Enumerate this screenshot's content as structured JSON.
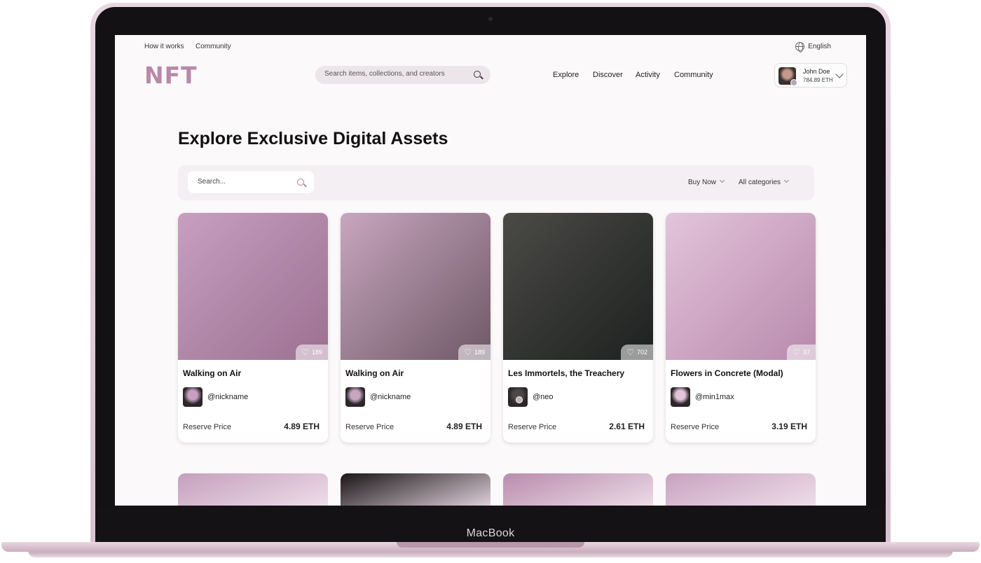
{
  "device": {
    "label": "MacBook"
  },
  "topbar": {
    "links": [
      "How it works",
      "Community"
    ],
    "language": "English"
  },
  "header": {
    "logo": "NFT",
    "search_placeholder": "Search items, collections, and creators",
    "nav": [
      "Explore",
      "Discover",
      "Activity",
      "Community"
    ],
    "user": {
      "name": "John Doe",
      "balance": "784.89 ETH"
    }
  },
  "main": {
    "title": "Explore Exclusive Digital Assets",
    "filter": {
      "search_placeholder": "Search...",
      "sale_type": "Buy Now",
      "category": "All categories"
    },
    "cards": [
      {
        "title": "Walking on Air",
        "nickname": "@nickname",
        "likes": "189",
        "price_label": "Reserve Price",
        "price": "4.89 ETH",
        "art_colors": [
          "#c79fc0",
          "#9c7091"
        ]
      },
      {
        "title": "Walking on Air",
        "nickname": "@nickname",
        "likes": "189",
        "price_label": "Reserve Price",
        "price": "4.89 ETH",
        "art_colors": [
          "#c8a6bf",
          "#6e5866"
        ]
      },
      {
        "title": "Les Immortels, the Treachery",
        "nickname": "@neo",
        "likes": "702",
        "price_label": "Reserve Price",
        "price": "2.61 ETH",
        "art_colors": [
          "#4b4a47",
          "#1d211f"
        ]
      },
      {
        "title": "Flowers in Concrete (Modal)",
        "nickname": "@min1max",
        "likes": "37",
        "price_label": "Reserve Price",
        "price": "3.19 ETH",
        "art_colors": [
          "#e3c4db",
          "#b88aac"
        ]
      }
    ],
    "second_row_colors": [
      "#c59fbd",
      "#1a1517",
      "#b98cad",
      "#c8a2c0"
    ]
  }
}
